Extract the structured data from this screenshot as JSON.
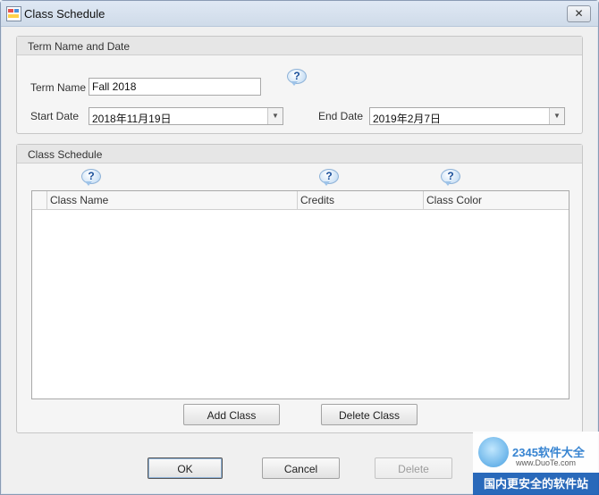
{
  "window": {
    "title": "Class Schedule",
    "close_glyph": "✕"
  },
  "term_group": {
    "title": "Term Name and Date",
    "term_name_label": "Term Name",
    "term_name_value": "Fall 2018",
    "start_date_label": "Start Date",
    "start_date_value": "2018年11月19日",
    "end_date_label": "End Date",
    "end_date_value": "2019年2月7日"
  },
  "schedule_group": {
    "title": "Class Schedule",
    "columns": [
      "Class Name",
      "Credits",
      "Class Color"
    ],
    "rows": [],
    "add_class_label": "Add Class",
    "delete_class_label": "Delete Class"
  },
  "help": {
    "glyph": "?"
  },
  "footer": {
    "ok_label": "OK",
    "cancel_label": "Cancel",
    "delete_label": "Delete"
  },
  "watermark": {
    "brand": "2345软件大全",
    "url": "www.DuoTe.com",
    "slogan": "国内更安全的软件站"
  },
  "colors": {
    "titlebar": "#d6e1ee",
    "dialog_bg": "#f0f0f0",
    "help_blue": "#1a4f9a",
    "watermark_blue": "#1f62b8"
  },
  "icons": {
    "app": "calendar-grid-icon",
    "close": "close-icon",
    "help": "help-question-icon",
    "dropdown": "chevron-down-icon"
  }
}
